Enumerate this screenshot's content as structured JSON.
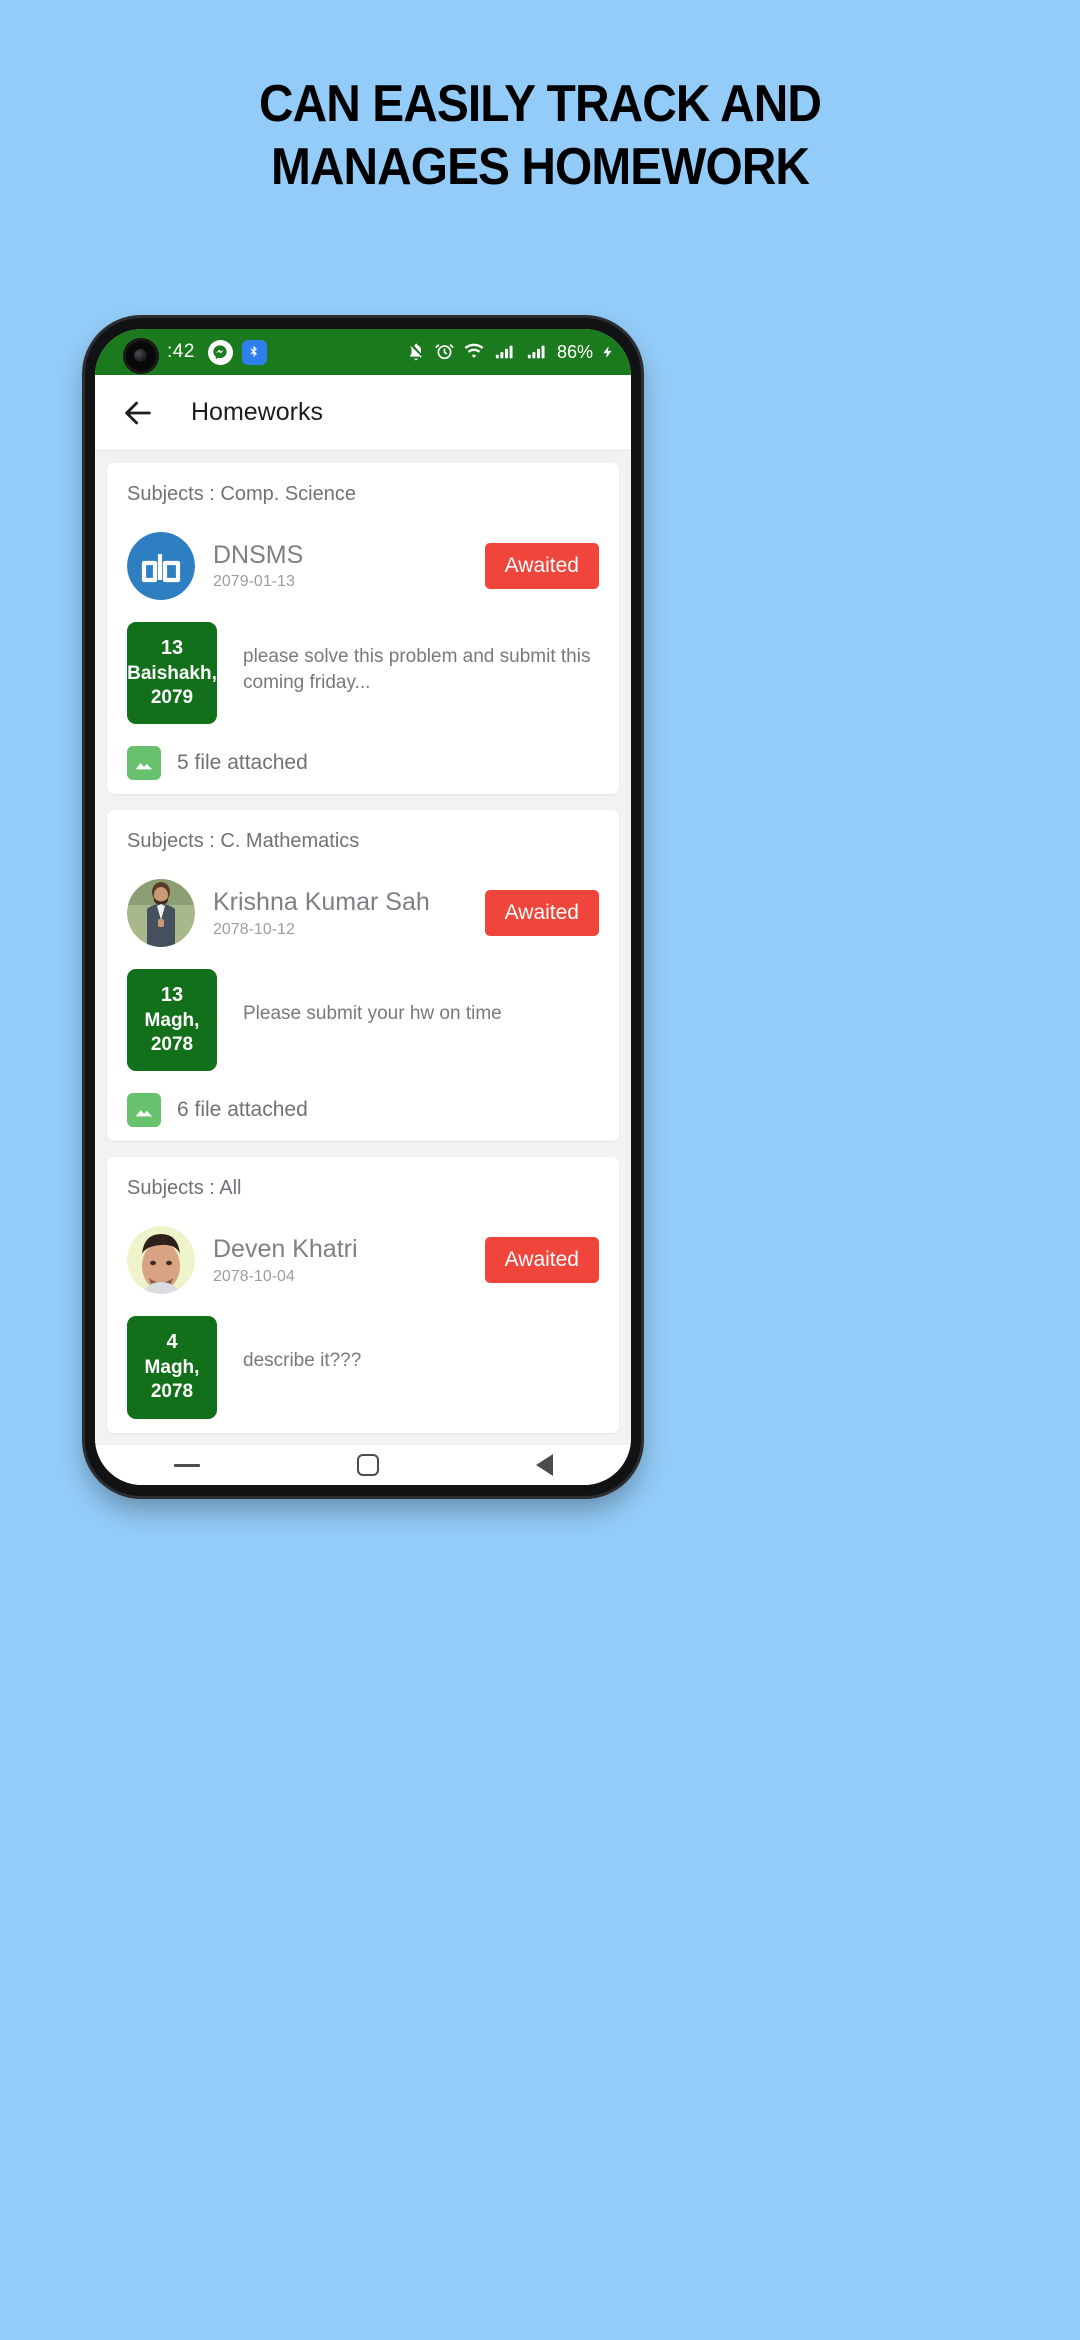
{
  "promo": {
    "line1": "CAN EASILY TRACK AND",
    "line2": "MANAGES HOMEWORK",
    "background_color": "#93CCF8"
  },
  "statusbar": {
    "time": ":42",
    "battery": "86%",
    "icons": [
      "messenger-icon",
      "bluetooth-app-icon",
      "notifications-off-icon",
      "alarm-icon",
      "wifi-icon",
      "signal-icon",
      "signal-icon",
      "charging-bolt-icon"
    ],
    "background_color": "#1C7A1E"
  },
  "appbar": {
    "back_label": "back-arrow",
    "title": "Homeworks"
  },
  "theme": {
    "accent_green": "#13701A",
    "badge_red": "#F0453A",
    "file_green": "#68C16C",
    "page_bg": "#F2F2F3"
  },
  "cards": [
    {
      "subject": "Subjects : Comp. Science",
      "author": "DNSMS",
      "posted_date": "2079-01-13",
      "status": "Awaited",
      "due_day": "13",
      "due_month": "Baishakh,",
      "due_year": "2079",
      "description": "please solve this problem and submit this coming friday...",
      "files": "5 file attached",
      "avatar_type": "logo-dn"
    },
    {
      "subject": "Subjects : C. Mathematics",
      "author": "Krishna Kumar Sah",
      "posted_date": "2078-10-12",
      "status": "Awaited",
      "due_day": "13",
      "due_month": "Magh,",
      "due_year": "2078",
      "description": "Please submit your hw on time",
      "files": "6 file attached",
      "avatar_type": "photo-man-suit"
    },
    {
      "subject": "Subjects : All",
      "author": "Deven Khatri",
      "posted_date": "2078-10-04",
      "status": "Awaited",
      "due_day": "4",
      "due_month": "Magh,",
      "due_year": "2078",
      "description": "describe it???",
      "files": "",
      "avatar_type": "photo-man-portrait"
    }
  ],
  "navbar": {
    "recent": "recent-apps-icon",
    "home": "home-icon",
    "back": "back-nav-icon"
  }
}
